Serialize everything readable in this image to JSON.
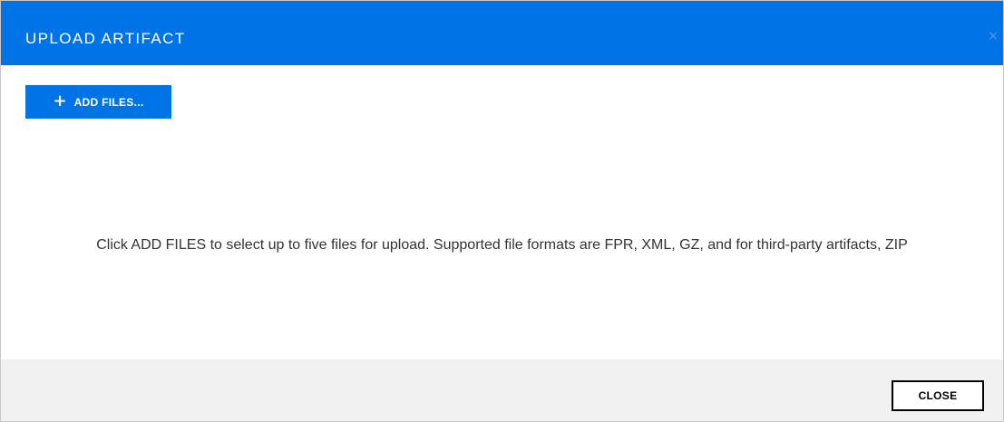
{
  "dialog": {
    "title": "UPLOAD ARTIFACT",
    "close_icon": "close-icon",
    "close_glyph": "×"
  },
  "toolbar": {
    "add_files_icon": "plus-icon",
    "add_files_glyph": "+",
    "add_files_label": "ADD FILES..."
  },
  "main": {
    "instructions": "Click ADD FILES to select up to five files for upload. Supported file formats are FPR, XML, GZ, and for third-party artifacts, ZIP"
  },
  "footer": {
    "close_label": "CLOSE"
  },
  "colors": {
    "header_bg": "#0073e7",
    "button_bg": "#0073e7",
    "footer_bg": "#f1f1f1",
    "text": "#333333"
  }
}
